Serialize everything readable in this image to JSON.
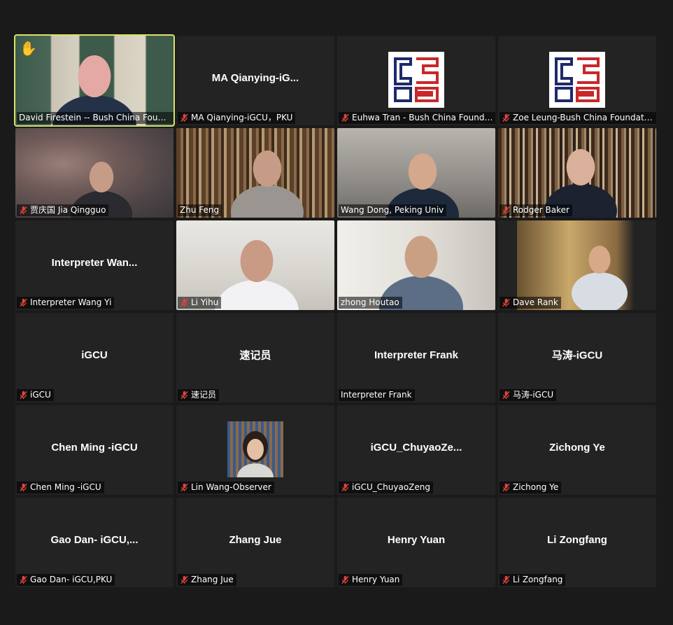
{
  "tiles": [
    {
      "label": "David Firestein -- Bush China Found...",
      "muted": false,
      "video": "office",
      "active": true,
      "hand": true
    },
    {
      "label": "MA Qianying-iGCU，PKU",
      "center": "MA  Qianying-iG...",
      "muted": true
    },
    {
      "label": "Euhwa Tran - Bush China Founda...",
      "muted": true,
      "logo": true
    },
    {
      "label": "Zoe Leung-Bush China Foundation",
      "muted": true,
      "logo": true
    },
    {
      "label": "贾庆国 Jia Qingguo",
      "muted": true,
      "video": "blur"
    },
    {
      "label": "Zhu Feng",
      "muted": false,
      "video": "books"
    },
    {
      "label": "Wang Dong, Peking Univ",
      "muted": false,
      "video": "gray"
    },
    {
      "label": "Rodger Baker",
      "muted": true,
      "video": "books2"
    },
    {
      "label": "Interpreter Wang Yi",
      "center": "Interpreter  Wan...",
      "muted": true
    },
    {
      "label": "Li Yihu",
      "muted": true,
      "video": "light"
    },
    {
      "label": "zhong Houtao",
      "muted": false,
      "video": "light2"
    },
    {
      "label": "Dave Rank",
      "muted": true,
      "video": "room"
    },
    {
      "label": "iGCU",
      "center": "iGCU",
      "muted": true
    },
    {
      "label": "速记员",
      "center": "速记员",
      "muted": true
    },
    {
      "label": "Interpreter Frank",
      "center": "Interpreter Frank",
      "muted": false
    },
    {
      "label": "马涛-iGCU",
      "center": "马涛-iGCU",
      "muted": true
    },
    {
      "label": "Chen Ming -iGCU",
      "center": "Chen Ming -iGCU",
      "muted": true
    },
    {
      "label": "Lin Wang-Observer",
      "muted": true,
      "avatar": true
    },
    {
      "label": "iGCU_ChuyaoZeng",
      "center": "iGCU_ChuyaoZe...",
      "muted": true
    },
    {
      "label": "Zichong Ye",
      "center": "Zichong Ye",
      "muted": true
    },
    {
      "label": "Gao Dan- iGCU,PKU",
      "center": "Gao Dan-  iGCU,...",
      "muted": true
    },
    {
      "label": "Zhang Jue",
      "center": "Zhang Jue",
      "muted": true
    },
    {
      "label": "Henry Yuan",
      "center": "Henry Yuan",
      "muted": true
    },
    {
      "label": "Li Zongfang",
      "center": "Li Zongfang",
      "muted": true
    }
  ],
  "icons": {
    "muted": "mic-off-icon",
    "hand": "raised-hand-icon"
  },
  "colors": {
    "active_border": "#d8e26a",
    "mute_red": "#e0433b",
    "tile_bg": "#232323"
  }
}
